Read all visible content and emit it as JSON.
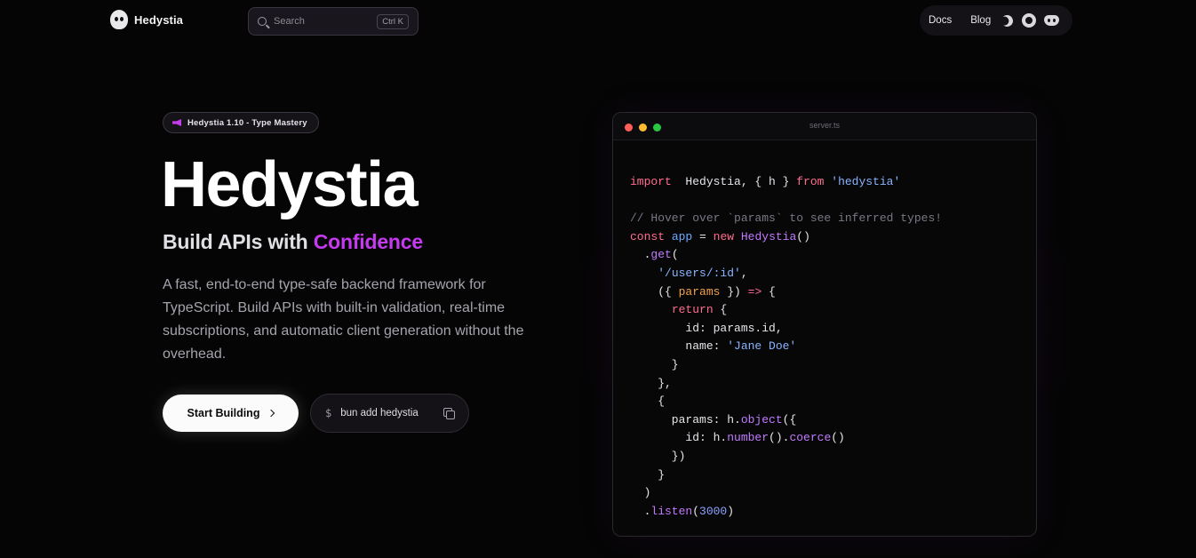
{
  "brand": {
    "name": "Hedystia"
  },
  "search": {
    "placeholder": "Search",
    "shortcut": "Ctrl K"
  },
  "nav": {
    "links": [
      "Docs",
      "Blog"
    ],
    "icons": [
      "moon-icon",
      "github-icon",
      "discord-icon"
    ]
  },
  "hero": {
    "badge": "Hedystia 1.10 - Type Mastery",
    "title": "Hedystia",
    "subtitle_prefix": "Build APIs with ",
    "subtitle_accent": "Confidence",
    "description": "A fast, end-to-end type-safe backend framework for TypeScript. Build APIs with built-in validation, real-time subscriptions, and automatic client generation without the overhead.",
    "cta_label": "Start Building",
    "install_prompt": "$",
    "install_command": "bun add hedystia"
  },
  "code": {
    "filename": "server.ts",
    "lines": [
      [
        [
          "kw",
          "import"
        ],
        [
          "",
          "  Hedystia, { h } "
        ],
        [
          "kw",
          "from"
        ],
        [
          "str",
          " 'hedystia'"
        ]
      ],
      [],
      [
        [
          "cm",
          "// Hover over `params` to see inferred types!"
        ]
      ],
      [
        [
          "kw",
          "const"
        ],
        [
          "",
          " "
        ],
        [
          "var",
          "app"
        ],
        [
          "",
          " = "
        ],
        [
          "kw",
          "new"
        ],
        [
          "",
          " "
        ],
        [
          "fn",
          "Hedystia"
        ],
        [
          "",
          "()"
        ]
      ],
      [
        [
          "",
          "  ."
        ],
        [
          "fn",
          "get"
        ],
        [
          "",
          "("
        ]
      ],
      [
        [
          "",
          "    "
        ],
        [
          "str",
          "'/users/:id'"
        ],
        [
          "",
          ","
        ]
      ],
      [
        [
          "",
          "    ({ "
        ],
        [
          "prm",
          "params"
        ],
        [
          "",
          " }) "
        ],
        [
          "kw",
          "=>"
        ],
        [
          "",
          " {"
        ]
      ],
      [
        [
          "",
          "      "
        ],
        [
          "kw",
          "return"
        ],
        [
          "",
          " {"
        ]
      ],
      [
        [
          "",
          "        id: params.id,"
        ]
      ],
      [
        [
          "",
          "        name: "
        ],
        [
          "str",
          "'Jane Doe'"
        ]
      ],
      [
        [
          "",
          "      }"
        ]
      ],
      [
        [
          "",
          "    },"
        ]
      ],
      [
        [
          "",
          "    {"
        ]
      ],
      [
        [
          "",
          "      params: h."
        ],
        [
          "fn",
          "object"
        ],
        [
          "",
          "({"
        ]
      ],
      [
        [
          "",
          "        id: h."
        ],
        [
          "fn",
          "number"
        ],
        [
          "",
          "()."
        ],
        [
          "fn",
          "coerce"
        ],
        [
          "",
          "()"
        ]
      ],
      [
        [
          "",
          "      })"
        ]
      ],
      [
        [
          "",
          "    }"
        ]
      ],
      [
        [
          "",
          "  )"
        ]
      ],
      [
        [
          "",
          "  ."
        ],
        [
          "fn",
          "listen"
        ],
        [
          "",
          "("
        ],
        [
          "num",
          "3000"
        ],
        [
          "",
          ")"
        ]
      ]
    ]
  },
  "colors": {
    "accent": "#c53af0",
    "background": "#050505"
  }
}
